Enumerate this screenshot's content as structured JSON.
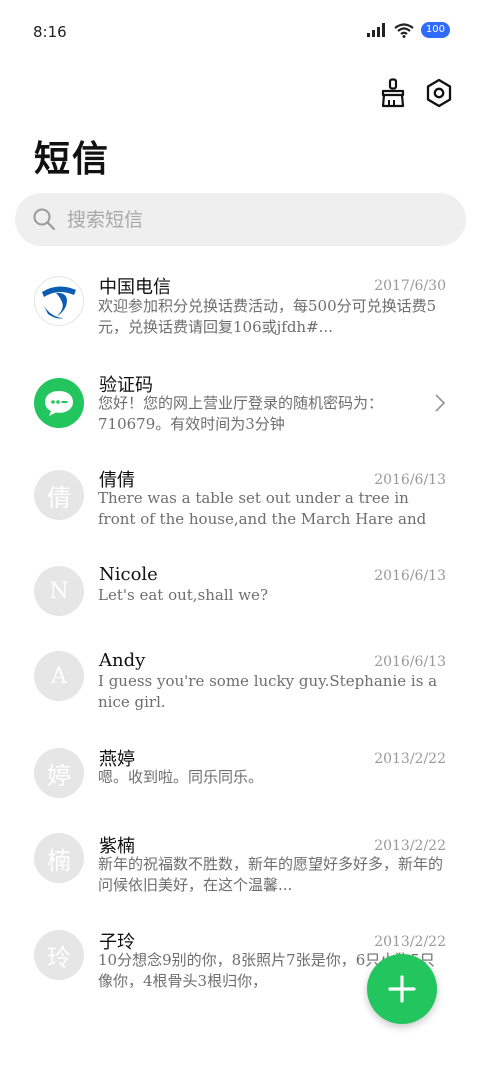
{
  "status_bar": {
    "time": "8:16",
    "battery": "100",
    "icons": [
      "signal-icon",
      "wifi-icon",
      "battery-icon"
    ]
  },
  "header": {
    "title": "短信",
    "actions": [
      "clean-brush-icon",
      "settings-hex-icon"
    ]
  },
  "search": {
    "placeholder": "搜索短信"
  },
  "threads": [
    {
      "name": "中国电信",
      "date": "2017/6/30",
      "preview": "欢迎参加积分兑换话费活动，每500分可兑换话费5元，兑换话费请回复106或jfdh#...",
      "avatar": "china-telecom-logo"
    },
    {
      "name": "验证码",
      "date": "",
      "preview": "您好！您的网上营业厅登录的随机密码为：710679。有效时间为3分钟",
      "avatar": "message-bubble-icon"
    },
    {
      "name": "倩倩",
      "date": "2016/6/13",
      "preview": "There was a table set out under a tree in front of the house,and the March Hare and the Hatte...",
      "avatar_text": "倩"
    },
    {
      "name": "Nicole",
      "date": "2016/6/13",
      "preview": "Let's eat out,shall we?",
      "avatar_text": "N"
    },
    {
      "name": "Andy",
      "date": "2016/6/13",
      "preview": "I guess you're some lucky guy.Stephanie is a nice girl.",
      "avatar_text": "A"
    },
    {
      "name": "燕婷",
      "date": "2013/2/22",
      "preview": "嗯。收到啦。同乐同乐。",
      "avatar_text": "婷"
    },
    {
      "name": "紫楠",
      "date": "2013/2/22",
      "preview": "新年的祝福数不胜数，新年的愿望好多好多，新年的问候依旧美好，在这个温馨...",
      "avatar_text": "楠"
    },
    {
      "name": "子玲",
      "date": "2013/2/22",
      "preview": "10分想念9别的你，8张照片7张是你，6只小狗5只像你，4根骨头3根归你，",
      "avatar_text": "玲"
    }
  ],
  "fab": {
    "icon": "plus-icon"
  },
  "colors": {
    "accent": "#22c55e",
    "battery": "#2f6bff",
    "telecom_blue": "#0b5db4"
  }
}
